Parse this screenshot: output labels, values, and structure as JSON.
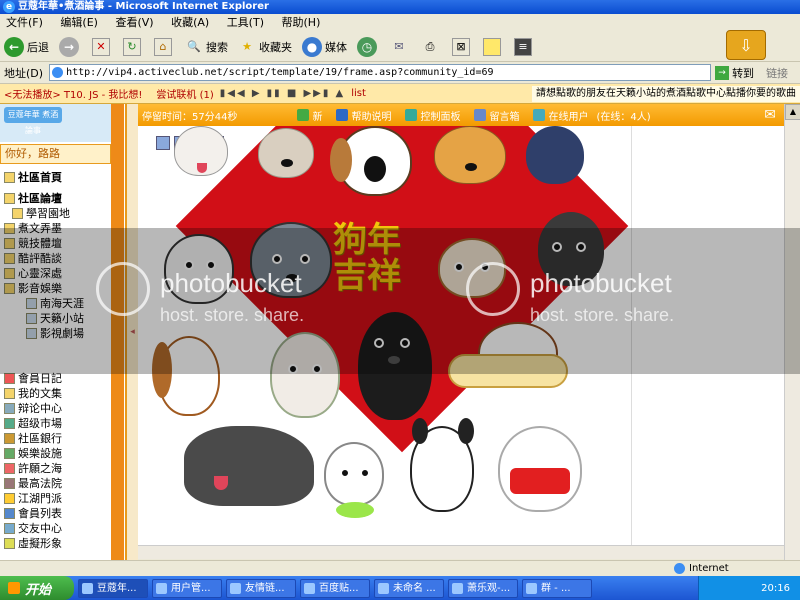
{
  "window": {
    "title": "豆蔻年華•煮酒論事 - Microsoft Internet Explorer"
  },
  "menu": [
    "文件(F)",
    "编辑(E)",
    "查看(V)",
    "收藏(A)",
    "工具(T)",
    "帮助(H)"
  ],
  "toolbar": {
    "back": "后退",
    "search": "搜索",
    "favorites": "收藏夹",
    "media": "媒体"
  },
  "address": {
    "label": "地址(D)",
    "url": "http://vip4.activeclub.net/script/template/19/frame.asp?community_id=69",
    "go": "转到",
    "links": "链接"
  },
  "sitebar": {
    "nowplaying": "<无法播放> T10. JS - 我比想!",
    "trial": "尝试联机 (1)",
    "list": "list",
    "marquee": "請想點歌的朋友在天籁小站的煮酒點歌中心點播你要的歌曲"
  },
  "sidebar": {
    "greeting": "你好，路路",
    "items": [
      {
        "label": "社區首頁",
        "bold": true
      },
      {
        "label": "社區論壇",
        "bold": true
      },
      {
        "label": "學習園地"
      },
      {
        "label": "煮文弄墨"
      },
      {
        "label": "競技體壇"
      },
      {
        "label": "酷評酷談"
      },
      {
        "label": "心靈深處"
      },
      {
        "label": "影音娛樂"
      },
      {
        "label": "南海天涯"
      },
      {
        "label": "天籟小站"
      },
      {
        "label": "影視劇場"
      }
    ],
    "bottom": [
      "會員日記",
      "我的文集",
      "辩论中心",
      "超级市場",
      "社區銀行",
      "娛樂設施",
      "許願之海",
      "最高法院",
      "江湖門派",
      "會員列表",
      "交友中心",
      "虛擬形象"
    ]
  },
  "header": {
    "stay": "停留时间：57分44秒",
    "new": "新",
    "help": "帮助说明",
    "control": "控制面板",
    "message": "留言箱",
    "online": "在线用户",
    "online_count": "(在线：4人)"
  },
  "content": {
    "fortune_line1": "狗年",
    "fortune_line2": "吉祥"
  },
  "watermark": {
    "brand": "photobucket",
    "tagline": "host. store. share."
  },
  "status": {
    "zone": "Internet"
  },
  "taskbar": {
    "start": "开始",
    "tasks": [
      "豆蔻年...",
      "用户管...",
      "友情链...",
      "百度贴...",
      "未命名 ...",
      "萧乐观-...",
      "群 - ..."
    ],
    "clock": "20:16"
  },
  "colors": {
    "accent": "#ee8a18",
    "diamond": "#d10f17",
    "gold": "#f2c40c"
  }
}
